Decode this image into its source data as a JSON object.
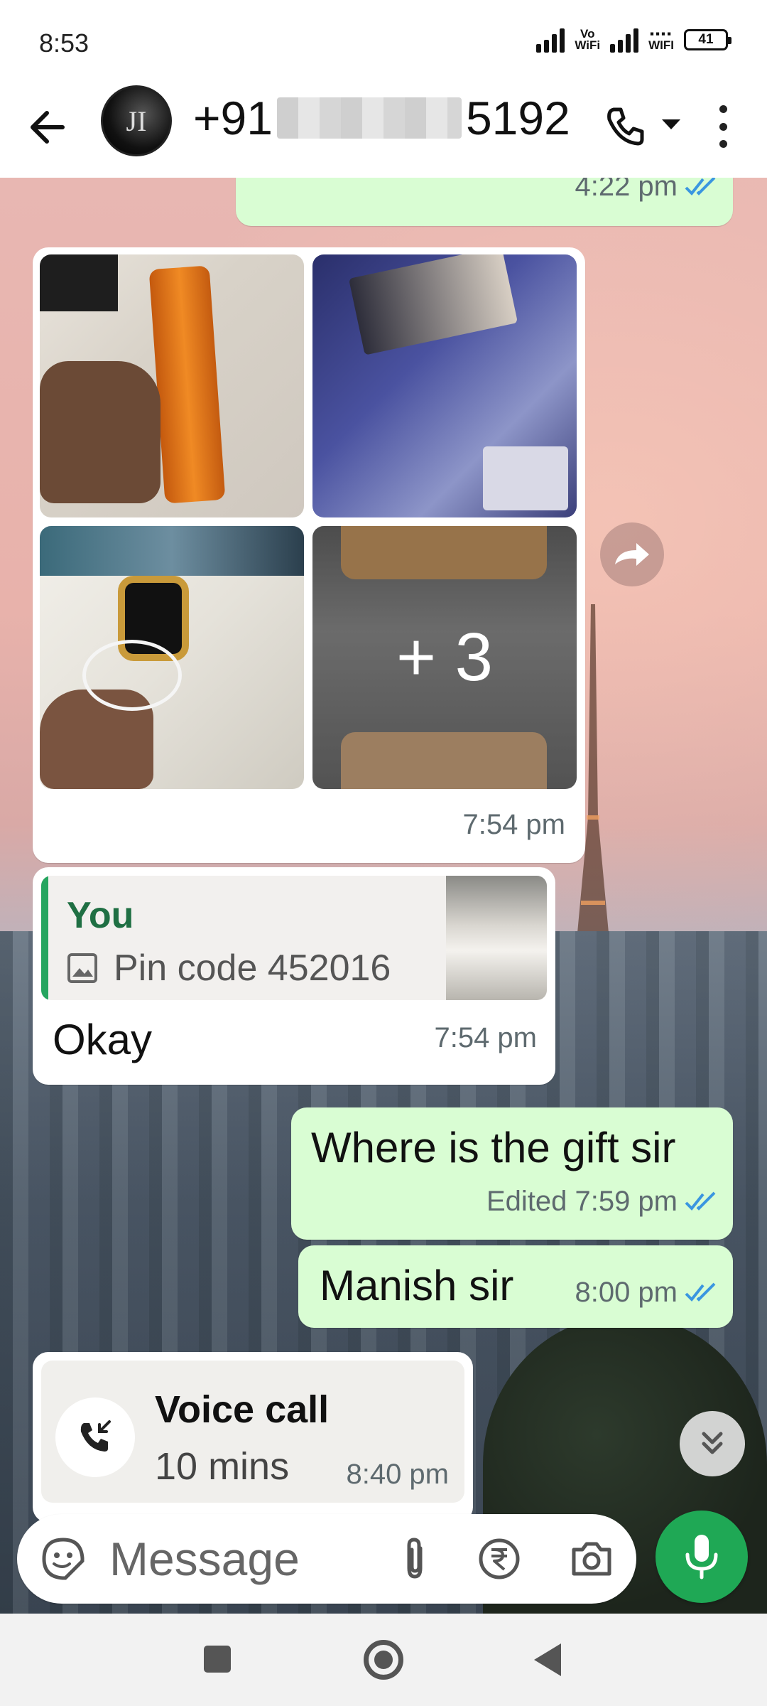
{
  "status_bar": {
    "time": "8:53",
    "network_1_label_top": "Vo",
    "network_1_label_bottom": "WiFi",
    "network_2_label": "WIFI",
    "battery": "41"
  },
  "header": {
    "avatar_letters": "JI",
    "contact_prefix": "+91",
    "contact_suffix": "5192"
  },
  "messages": {
    "top_partial": {
      "time": "4:22 pm"
    },
    "photo_album": {
      "more_count": "+ 3",
      "time": "7:54 pm"
    },
    "reply": {
      "quoted_author": "You",
      "quoted_text": "Pin code 452016",
      "text": "Okay",
      "time": "7:54 pm"
    },
    "gift": {
      "text": "Where is the gift sir",
      "status": "Edited 7:59 pm"
    },
    "manish": {
      "text": "Manish sir",
      "time": "8:00 pm"
    },
    "voice_call": {
      "title": "Voice call",
      "duration": "10 mins",
      "time": "8:40 pm"
    }
  },
  "composer": {
    "placeholder": "Message"
  },
  "colors": {
    "outgoing_bubble": "#d9fdd3",
    "incoming_bubble": "#ffffff",
    "accent_green": "#1fa855",
    "read_ticks": "#3a96e0",
    "reply_name": "#1f6f43"
  },
  "icons": {
    "back": "back-arrow-icon",
    "call": "phone-icon",
    "more": "more-vert-icon",
    "forward": "forward-icon",
    "image": "image-icon",
    "missed_call": "incoming-call-icon",
    "scroll": "double-chevron-down-icon",
    "emoji": "sticker-icon",
    "attach": "paperclip-icon",
    "payment": "rupee-icon",
    "camera": "camera-icon",
    "mic": "mic-icon"
  }
}
